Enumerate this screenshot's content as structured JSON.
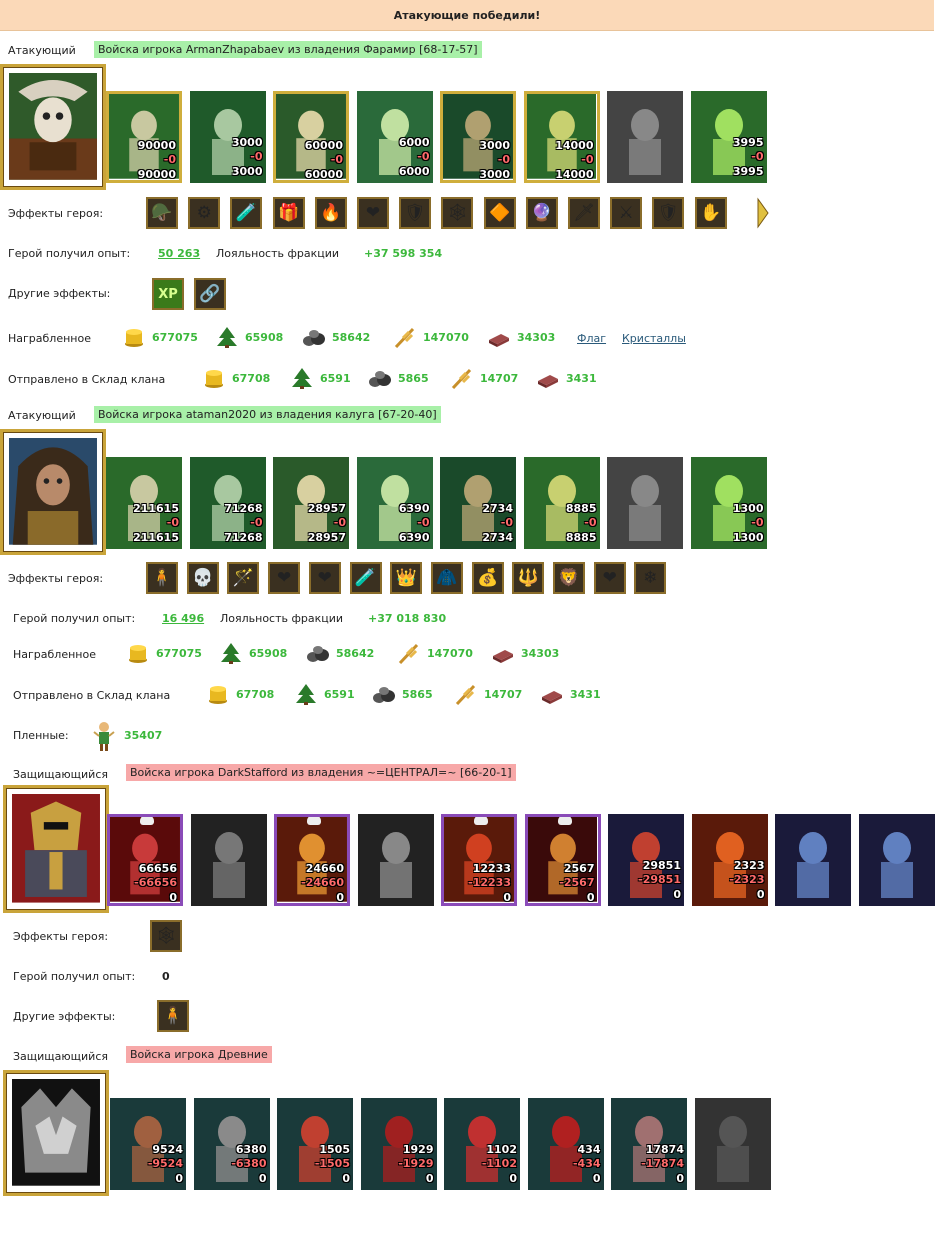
{
  "banner": "Атакующие победили!",
  "labels": {
    "attacker": "Атакующий",
    "defender": "Защищающийся",
    "hero_effects": "Эффекты героя:",
    "hero_exp": "Герой получил опыт:",
    "loyalty": "Лояльность фракции",
    "other_effects": "Другие эффекты:",
    "looted": "Награбленное",
    "sent": "Отправлено в Склад клана",
    "prisoners": "Пленные:"
  },
  "attacker1": {
    "title": "Войска игрока ArmanZhapabaev из владения Фарамир [68-17-57]",
    "units": [
      {
        "a": "90000",
        "b": "-0",
        "c": "90000"
      },
      {
        "a": "3000",
        "b": "-0",
        "c": "3000"
      },
      {
        "a": "60000",
        "b": "-0",
        "c": "60000"
      },
      {
        "a": "6000",
        "b": "-0",
        "c": "6000"
      },
      {
        "a": "3000",
        "b": "-0",
        "c": "3000"
      },
      {
        "a": "14000",
        "b": "-0",
        "c": "14000"
      },
      {
        "a": "",
        "b": "",
        "c": ""
      },
      {
        "a": "3995",
        "b": "-0",
        "c": "3995"
      }
    ],
    "exp": "50 263",
    "loyalty": "+37 598 354",
    "loot": [
      "677075",
      "65908",
      "58642",
      "147070",
      "34303"
    ],
    "flag": "Флаг",
    "crystals": "Кристаллы",
    "sent": [
      "67708",
      "6591",
      "5865",
      "14707",
      "3431"
    ]
  },
  "attacker2": {
    "title": "Войска игрока ataman2020 из владения калуга [67-20-40]",
    "units": [
      {
        "a": "211615",
        "b": "-0",
        "c": "211615"
      },
      {
        "a": "71268",
        "b": "-0",
        "c": "71268"
      },
      {
        "a": "28957",
        "b": "-0",
        "c": "28957"
      },
      {
        "a": "6390",
        "b": "-0",
        "c": "6390"
      },
      {
        "a": "2734",
        "b": "-0",
        "c": "2734"
      },
      {
        "a": "8885",
        "b": "-0",
        "c": "8885"
      },
      {
        "a": "",
        "b": "",
        "c": ""
      },
      {
        "a": "1300",
        "b": "-0",
        "c": "1300"
      }
    ],
    "exp": "16 496",
    "loyalty": "+37 018 830",
    "loot": [
      "677075",
      "65908",
      "58642",
      "147070",
      "34303"
    ],
    "sent": [
      "67708",
      "6591",
      "5865",
      "14707",
      "3431"
    ],
    "prisoners": "35407"
  },
  "defender1": {
    "title": "Войска игрока DarkStafford из владения ~=ЦЕНТРАЛ=~ [66-20-1]",
    "units": [
      {
        "a": "66656",
        "b": "-66656",
        "c": "0"
      },
      {
        "a": "",
        "b": "",
        "c": ""
      },
      {
        "a": "24660",
        "b": "-24660",
        "c": "0"
      },
      {
        "a": "",
        "b": "",
        "c": ""
      },
      {
        "a": "12233",
        "b": "-12233",
        "c": "0"
      },
      {
        "a": "2567",
        "b": "-2567",
        "c": "0"
      },
      {
        "a": "29851",
        "b": "-29851",
        "c": "0"
      },
      {
        "a": "2323",
        "b": "-2323",
        "c": "0"
      },
      {
        "a": "",
        "b": "",
        "c": ""
      },
      {
        "a": "",
        "b": "",
        "c": ""
      }
    ],
    "exp": "0"
  },
  "defender2": {
    "title": "Войска игрока Древние",
    "units": [
      {
        "a": "9524",
        "b": "-9524",
        "c": "0"
      },
      {
        "a": "6380",
        "b": "-6380",
        "c": "0"
      },
      {
        "a": "1505",
        "b": "-1505",
        "c": "0"
      },
      {
        "a": "1929",
        "b": "-1929",
        "c": "0"
      },
      {
        "a": "1102",
        "b": "-1102",
        "c": "0"
      },
      {
        "a": "434",
        "b": "-434",
        "c": "0"
      },
      {
        "a": "17874",
        "b": "-17874",
        "c": "0"
      },
      {
        "a": "",
        "b": "",
        "c": ""
      }
    ]
  },
  "effects": {
    "a1": [
      "🪖",
      "⚙",
      "🧪",
      "🎁",
      "🔥",
      "❤",
      "🛡",
      "🕸",
      "🔶",
      "🔮",
      "🗡",
      "⚔",
      "🛡",
      "✋"
    ],
    "a1_other": [
      "XP",
      "🔗"
    ],
    "a2": [
      "🧍",
      "💀",
      "🪄",
      "❤",
      "❤",
      "🧪",
      "👑",
      "🧥",
      "💰",
      "🔱",
      "🦁",
      "❤",
      "❄"
    ],
    "d1": [
      "🕸"
    ],
    "d1_other": [
      "🧍"
    ]
  },
  "colors": {
    "banner_bg": "#fbd9b8",
    "attacker_tag": "#a8f0a8",
    "defender_tag": "#f7a8a8",
    "resource_value": "#3cb83c",
    "loss_value": "#ff6a6a"
  }
}
